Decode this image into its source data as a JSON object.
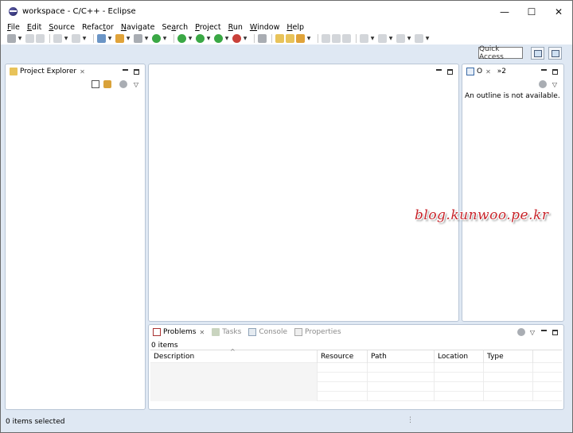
{
  "window": {
    "title": "workspace - C/C++ - Eclipse",
    "controls": {
      "minimize": "—",
      "maximize": "☐",
      "close": "✕"
    }
  },
  "menu": {
    "items": [
      {
        "mnemonic": "F",
        "rest": "ile"
      },
      {
        "mnemonic": "E",
        "rest": "dit"
      },
      {
        "mnemonic": "S",
        "rest": "ource"
      },
      {
        "pre": "Refac",
        "mnemonic": "t",
        "rest": "or"
      },
      {
        "mnemonic": "N",
        "rest": "avigate"
      },
      {
        "pre": "Se",
        "mnemonic": "a",
        "rest": "rch"
      },
      {
        "mnemonic": "P",
        "rest": "roject"
      },
      {
        "mnemonic": "R",
        "rest": "un"
      },
      {
        "mnemonic": "W",
        "rest": "indow"
      },
      {
        "mnemonic": "H",
        "rest": "elp"
      }
    ]
  },
  "perspective": {
    "quick_access": "Quick Access"
  },
  "project_explorer": {
    "tab_label": "Project Explorer"
  },
  "outline": {
    "tab_label": "O",
    "overflow_label": "»2",
    "message": "An outline is not available."
  },
  "bottom_panel": {
    "tabs": [
      {
        "label": "Problems",
        "active": true
      },
      {
        "label": "Tasks",
        "active": false
      },
      {
        "label": "Console",
        "active": false
      },
      {
        "label": "Properties",
        "active": false
      }
    ],
    "items_count": "0 items",
    "columns": [
      "Description",
      "Resource",
      "Path",
      "Location",
      "Type"
    ]
  },
  "status": {
    "text": "0 items selected"
  },
  "watermark": "blog.kunwoo.pe.kr",
  "colors": {
    "chrome": "#dfe8f3",
    "panel_border": "#b9c6d6",
    "watermark": "#c8262c"
  }
}
